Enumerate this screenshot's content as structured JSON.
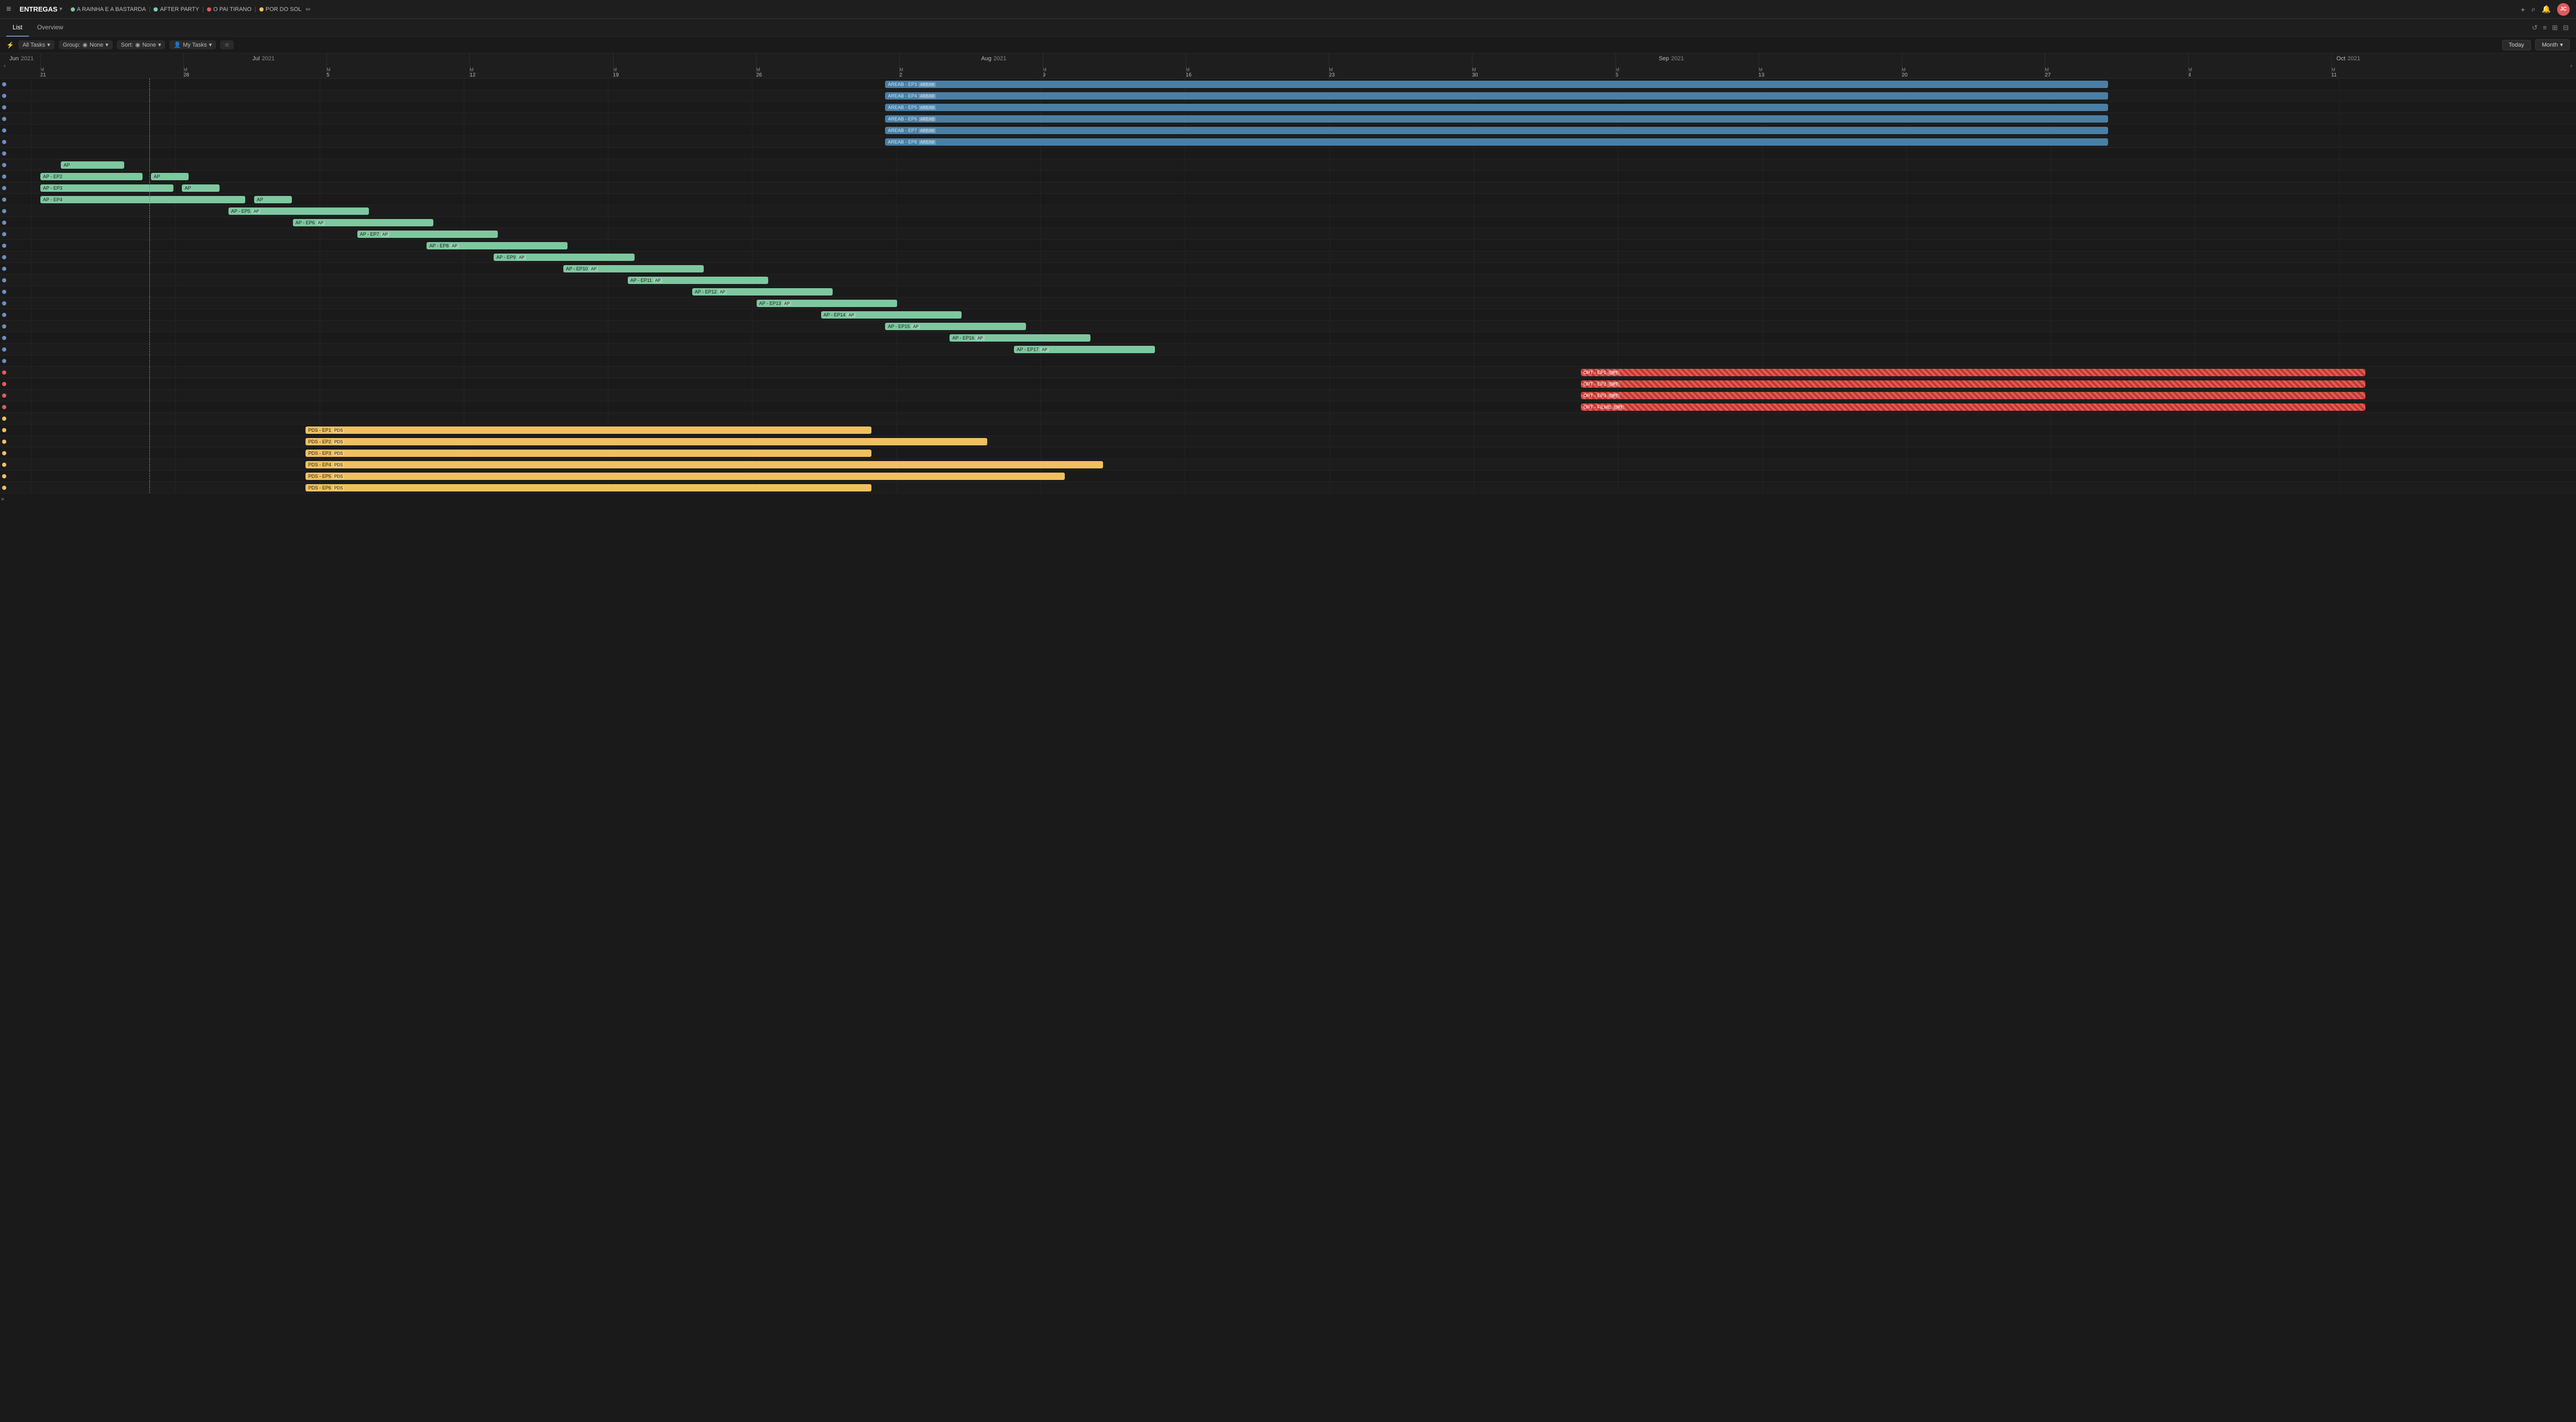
{
  "app": {
    "title": "ENTREGAS",
    "menu_icon": "≡",
    "chevron": "▾"
  },
  "tags": [
    {
      "id": "tag-1",
      "label": "A RAINHA E A BASTARDA",
      "color": "#7ec8a0",
      "sep": "|"
    },
    {
      "id": "tag-2",
      "label": "AFTER PARTY",
      "color": "#7ec8c8",
      "sep": "|"
    },
    {
      "id": "tag-3",
      "label": "O PAI TIRANO",
      "color": "#e05c5c",
      "sep": "|"
    },
    {
      "id": "tag-4",
      "label": "POR DO SOL",
      "color": "#f0c060",
      "sep": ""
    }
  ],
  "topbar_actions": {
    "plus": "+",
    "search": "⌕",
    "bell": "🔔",
    "avatar": "JC"
  },
  "toolbar": {
    "list_label": "List",
    "overview_label": "Overview",
    "icons": [
      "↺",
      "≡",
      "⊞",
      "⊟"
    ]
  },
  "filters": {
    "filter_icon": "⚡",
    "all_tasks": "All Tasks",
    "group": "Group:",
    "none_group": "None",
    "sort": "Sort:",
    "none_sort": "None",
    "my_tasks": "My Tasks",
    "star": "☆",
    "today": "Today",
    "month": "Month"
  },
  "timeline": {
    "months": [
      {
        "label": "Jun",
        "year": "2021",
        "left_pct": 0
      },
      {
        "label": "Jul",
        "year": "2021",
        "left_pct": 9.5
      },
      {
        "label": "Aug",
        "year": "2021",
        "left_pct": 38
      },
      {
        "label": "Sep",
        "year": "2021",
        "left_pct": 64.5
      },
      {
        "label": "Oct",
        "year": "2021",
        "left_pct": 91
      }
    ],
    "weeks": [
      {
        "day": "M",
        "date": "21",
        "left_pct": 1.2
      },
      {
        "day": "M",
        "date": "28",
        "left_pct": 6.8
      },
      {
        "day": "M",
        "date": "5",
        "left_pct": 12.4
      },
      {
        "day": "M",
        "date": "12",
        "left_pct": 18.0
      },
      {
        "day": "M",
        "date": "19",
        "left_pct": 23.6
      },
      {
        "day": "M",
        "date": "26",
        "left_pct": 29.2
      },
      {
        "day": "M",
        "date": "2",
        "left_pct": 34.8
      },
      {
        "day": "M",
        "date": "9",
        "left_pct": 40.4
      },
      {
        "day": "M",
        "date": "16",
        "left_pct": 46.0
      },
      {
        "day": "M",
        "date": "23",
        "left_pct": 51.6
      },
      {
        "day": "M",
        "date": "30",
        "left_pct": 57.2
      },
      {
        "day": "M",
        "date": "6",
        "left_pct": 62.8
      },
      {
        "day": "M",
        "date": "13",
        "left_pct": 68.4
      },
      {
        "day": "M",
        "date": "20",
        "left_pct": 74.0
      },
      {
        "day": "M",
        "date": "27",
        "left_pct": 79.6
      },
      {
        "day": "M",
        "date": "4",
        "left_pct": 85.2
      },
      {
        "day": "M",
        "date": "11",
        "left_pct": 90.8
      }
    ]
  },
  "rows": [
    {
      "id": "r1",
      "dot": "blue",
      "bars": [
        {
          "label": "AREAB - EP3",
          "tag": "AREAB",
          "class": "bar-blue",
          "left": 34.0,
          "width": 47.5
        }
      ]
    },
    {
      "id": "r2",
      "dot": "blue",
      "bars": [
        {
          "label": "AREAB - EP4",
          "tag": "AREAB",
          "class": "bar-blue",
          "left": 34.0,
          "width": 47.5
        }
      ]
    },
    {
      "id": "r3",
      "dot": "blue",
      "bars": [
        {
          "label": "AREAB - EP5",
          "tag": "AREAB",
          "class": "bar-blue",
          "left": 34.0,
          "width": 47.5
        }
      ]
    },
    {
      "id": "r4",
      "dot": "blue",
      "bars": [
        {
          "label": "AREAB - EP6",
          "tag": "AREAB",
          "class": "bar-blue",
          "left": 34.0,
          "width": 47.5
        }
      ]
    },
    {
      "id": "r5",
      "dot": "blue",
      "bars": [
        {
          "label": "AREAB - EP7",
          "tag": "AREAB",
          "class": "bar-blue",
          "left": 34.0,
          "width": 47.5
        }
      ]
    },
    {
      "id": "r6",
      "dot": "blue",
      "bars": [
        {
          "label": "AREAB - EP8",
          "tag": "AREAB",
          "class": "bar-blue",
          "left": 34.0,
          "width": 47.5
        }
      ]
    },
    {
      "id": "r7",
      "dot": "blue",
      "bars": []
    },
    {
      "id": "r8",
      "dot": "blue",
      "bars": [
        {
          "label": "AP",
          "tag": "",
          "class": "bar-green",
          "left": 2.0,
          "width": 2.5
        }
      ]
    },
    {
      "id": "r9",
      "dot": "blue",
      "bars": [
        {
          "label": "AP - EP2",
          "tag": "",
          "class": "bar-green",
          "left": 1.2,
          "width": 4.0
        },
        {
          "label": "AP",
          "tag": "",
          "class": "bar-green",
          "left": 5.5,
          "width": 1.5
        }
      ]
    },
    {
      "id": "r10",
      "dot": "blue",
      "bars": [
        {
          "label": "AP - EP3",
          "tag": "",
          "class": "bar-green",
          "left": 1.2,
          "width": 5.2
        },
        {
          "label": "AP",
          "tag": "",
          "class": "bar-green",
          "left": 6.7,
          "width": 1.5
        }
      ]
    },
    {
      "id": "r11",
      "dot": "blue",
      "bars": [
        {
          "label": "AP - EP4",
          "tag": "",
          "class": "bar-green",
          "left": 1.2,
          "width": 8.0
        },
        {
          "label": "AP",
          "tag": "",
          "class": "bar-green",
          "left": 9.5,
          "width": 1.5
        }
      ]
    },
    {
      "id": "r12",
      "dot": "blue",
      "bars": [
        {
          "label": "AP - EP5",
          "tag": "AP",
          "class": "bar-green",
          "left": 8.5,
          "width": 5.5
        }
      ]
    },
    {
      "id": "r13",
      "dot": "blue",
      "bars": [
        {
          "label": "AP - EP6",
          "tag": "AP",
          "class": "bar-green",
          "left": 11.0,
          "width": 5.5
        }
      ]
    },
    {
      "id": "r14",
      "dot": "blue",
      "bars": [
        {
          "label": "AP - EP7",
          "tag": "AP",
          "class": "bar-green",
          "left": 13.5,
          "width": 5.5
        }
      ]
    },
    {
      "id": "r15",
      "dot": "blue",
      "bars": [
        {
          "label": "AP - EP8",
          "tag": "AP",
          "class": "bar-green",
          "left": 16.2,
          "width": 5.5
        }
      ]
    },
    {
      "id": "r16",
      "dot": "blue",
      "bars": [
        {
          "label": "AP - EP9",
          "tag": "AP",
          "class": "bar-green",
          "left": 18.8,
          "width": 5.5
        }
      ]
    },
    {
      "id": "r17",
      "dot": "blue",
      "bars": [
        {
          "label": "AP - EP10",
          "tag": "AP",
          "class": "bar-green",
          "left": 21.5,
          "width": 5.5
        }
      ]
    },
    {
      "id": "r18",
      "dot": "blue",
      "bars": [
        {
          "label": "AP - EP11",
          "tag": "AP",
          "class": "bar-green",
          "left": 24.0,
          "width": 5.5
        }
      ]
    },
    {
      "id": "r19",
      "dot": "blue",
      "bars": [
        {
          "label": "AP - EP12",
          "tag": "AP",
          "class": "bar-green",
          "left": 26.5,
          "width": 5.5
        }
      ]
    },
    {
      "id": "r20",
      "dot": "blue",
      "bars": [
        {
          "label": "AP - EP13",
          "tag": "AP",
          "class": "bar-green",
          "left": 29.0,
          "width": 5.5
        }
      ]
    },
    {
      "id": "r21",
      "dot": "blue",
      "bars": [
        {
          "label": "AP - EP14",
          "tag": "AP",
          "class": "bar-green",
          "left": 31.5,
          "width": 5.5
        }
      ]
    },
    {
      "id": "r22",
      "dot": "blue",
      "bars": [
        {
          "label": "AP - EP15",
          "tag": "AP",
          "class": "bar-green",
          "left": 34.0,
          "width": 5.5
        }
      ]
    },
    {
      "id": "r23",
      "dot": "blue",
      "bars": [
        {
          "label": "AP - EP16",
          "tag": "AP",
          "class": "bar-green",
          "left": 36.5,
          "width": 5.5
        }
      ]
    },
    {
      "id": "r24",
      "dot": "blue",
      "bars": [
        {
          "label": "AP - EP17",
          "tag": "AP",
          "class": "bar-green",
          "left": 39.0,
          "width": 5.5
        }
      ]
    },
    {
      "id": "r25",
      "dot": "blue",
      "bars": []
    },
    {
      "id": "r26",
      "dot": "red",
      "bars": [
        {
          "label": "OPT - EP1",
          "tag": "OPT",
          "class": "bar-red",
          "left": 61.0,
          "width": 30.5
        }
      ]
    },
    {
      "id": "r27",
      "dot": "red",
      "bars": [
        {
          "label": "OPT - EP2",
          "tag": "OPT",
          "class": "bar-red",
          "left": 61.0,
          "width": 30.5
        }
      ]
    },
    {
      "id": "r28",
      "dot": "red",
      "bars": [
        {
          "label": "OPT - EP3",
          "tag": "OPT",
          "class": "bar-red",
          "left": 61.0,
          "width": 30.5
        }
      ]
    },
    {
      "id": "r29",
      "dot": "red",
      "bars": [
        {
          "label": "OPT - FILME",
          "tag": "OPT",
          "class": "bar-red",
          "left": 61.0,
          "width": 30.5
        }
      ]
    },
    {
      "id": "r30",
      "dot": "yellow",
      "bars": []
    },
    {
      "id": "r31",
      "dot": "yellow",
      "bars": [
        {
          "label": "PDS - EP1",
          "tag": "PDS",
          "class": "bar-yellow",
          "left": 11.5,
          "width": 22.0
        }
      ]
    },
    {
      "id": "r32",
      "dot": "yellow",
      "bars": [
        {
          "label": "PDS - EP2",
          "tag": "PDS",
          "class": "bar-yellow",
          "left": 11.5,
          "width": 26.5
        }
      ]
    },
    {
      "id": "r33",
      "dot": "yellow",
      "bars": [
        {
          "label": "PDS - EP3",
          "tag": "PDS",
          "class": "bar-yellow",
          "left": 11.5,
          "width": 22.0
        }
      ]
    },
    {
      "id": "r34",
      "dot": "yellow",
      "bars": [
        {
          "label": "PDS - EP4",
          "tag": "PDS",
          "class": "bar-yellow",
          "left": 11.5,
          "width": 31.0
        }
      ]
    },
    {
      "id": "r35",
      "dot": "yellow",
      "bars": [
        {
          "label": "PDS - EP5",
          "tag": "PDS",
          "class": "bar-yellow",
          "left": 11.5,
          "width": 29.5
        }
      ]
    },
    {
      "id": "r36",
      "dot": "yellow",
      "bars": [
        {
          "label": "PDS - EP6",
          "tag": "PDS",
          "class": "bar-yellow",
          "left": 11.5,
          "width": 22.0
        }
      ]
    }
  ],
  "today_line_pct": 5.8,
  "expand_icon": "»"
}
